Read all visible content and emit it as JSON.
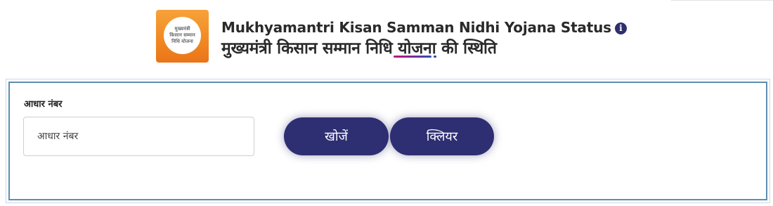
{
  "header": {
    "logo": {
      "lines": [
        "मुख्यमंत्री",
        "किसान सम्मान",
        "निधि योजना"
      ],
      "color": "#F18A24"
    },
    "title_en": "Mukhyamantri Kisan Samman Nidhi Yojana Status",
    "title_hi": "मुख्यमंत्री किसान सम्मान निधि योजना की स्थिति",
    "info_icon": "info-circle-icon",
    "info_glyph": "i"
  },
  "form": {
    "aadhaar_label": "आधार नंबर",
    "aadhaar_placeholder": "आधार नंबर",
    "aadhaar_value": "",
    "search_label": "खोजें",
    "clear_label": "क्लियर"
  },
  "colors": {
    "button_bg": "#2E2E72",
    "card_border": "#5F8DAE",
    "text": "#2A2A2A"
  }
}
